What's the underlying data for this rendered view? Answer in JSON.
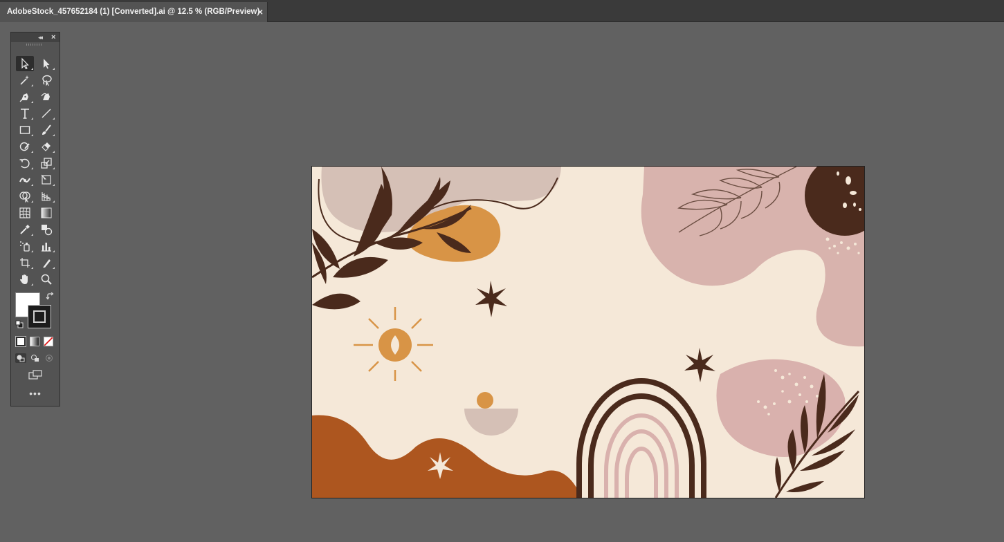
{
  "document_tab": {
    "title": "AdobeStock_457652184 (1) [Converted].ai @ 12.5 % (RGB/Preview)",
    "close_glyph": "×"
  },
  "toolbar": {
    "collapse_glyph": "◂◂",
    "close_glyph": "×",
    "more_glyph": "•••",
    "tools": [
      {
        "name": "selection-tool",
        "icon": "arrow-icon"
      },
      {
        "name": "direct-selection-tool",
        "icon": "white-arrow-icon"
      },
      {
        "name": "magic-wand-tool",
        "icon": "magic-wand-icon"
      },
      {
        "name": "lasso-tool",
        "icon": "lasso-icon"
      },
      {
        "name": "pen-tool",
        "icon": "pen-icon"
      },
      {
        "name": "curvature-tool",
        "icon": "curvature-pen-icon"
      },
      {
        "name": "type-tool",
        "icon": "type-icon"
      },
      {
        "name": "line-segment-tool",
        "icon": "line-icon"
      },
      {
        "name": "rectangle-tool",
        "icon": "rectangle-icon"
      },
      {
        "name": "paintbrush-tool",
        "icon": "brush-icon"
      },
      {
        "name": "shaper-tool",
        "icon": "shaper-icon"
      },
      {
        "name": "eraser-tool",
        "icon": "eraser-icon"
      },
      {
        "name": "rotate-tool",
        "icon": "rotate-icon"
      },
      {
        "name": "scale-tool",
        "icon": "scale-icon"
      },
      {
        "name": "width-tool",
        "icon": "width-icon"
      },
      {
        "name": "free-transform-tool",
        "icon": "free-transform-icon"
      },
      {
        "name": "shape-builder-tool",
        "icon": "shape-builder-icon"
      },
      {
        "name": "perspective-grid-tool",
        "icon": "perspective-grid-icon"
      },
      {
        "name": "mesh-tool",
        "icon": "mesh-icon"
      },
      {
        "name": "gradient-tool",
        "icon": "gradient-icon"
      },
      {
        "name": "eyedropper-tool",
        "icon": "eyedropper-icon"
      },
      {
        "name": "blend-tool",
        "icon": "blend-icon"
      },
      {
        "name": "symbol-sprayer-tool",
        "icon": "symbol-sprayer-icon"
      },
      {
        "name": "column-graph-tool",
        "icon": "column-graph-icon"
      },
      {
        "name": "artboard-tool",
        "icon": "artboard-icon"
      },
      {
        "name": "slice-tool",
        "icon": "slice-icon"
      },
      {
        "name": "hand-tool",
        "icon": "hand-icon"
      },
      {
        "name": "zoom-tool",
        "icon": "zoom-icon"
      }
    ]
  },
  "colors": {
    "app_bg": "#616161",
    "panel_bg": "#535353",
    "artboard_bg": "#f5e8d8",
    "blush": "#d8b3ad",
    "taupe": "#d5c0b6",
    "ochre": "#d89446",
    "rust": "#ad561f",
    "dark_brown": "#4a2a1c",
    "pale_pink": "#d9b1ad"
  }
}
